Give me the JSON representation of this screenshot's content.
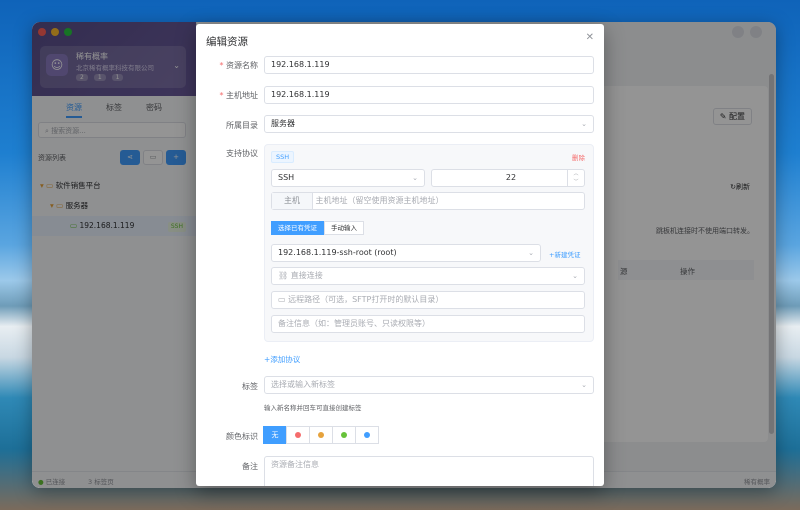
{
  "sidebar": {
    "org_name": "稀有概率",
    "org_sub": "北京稀有概率科技有限公司",
    "stats": [
      "2",
      "1",
      "1"
    ],
    "tabs": [
      "资源",
      "标签",
      "密码"
    ],
    "search_placeholder": "搜索资源...",
    "list_title": "资源列表",
    "tree": [
      {
        "label": "软件销售平台"
      },
      {
        "label": "服务器"
      },
      {
        "label": "192.168.1.119",
        "tag": "SSH"
      }
    ]
  },
  "footer": {
    "connected": "已连接",
    "count": "3 标签页",
    "right": "稀有概率"
  },
  "main": {
    "config": "配置",
    "refresh": "刷新",
    "note": "跳板机连接时不使用端口转发。",
    "col_op": "操作",
    "col_a": "源"
  },
  "dialog": {
    "title": "编辑资源",
    "name_label": "资源名称",
    "name_value": "192.168.1.119",
    "host_label": "主机地址",
    "host_value": "192.168.1.119",
    "dir_label": "所属目录",
    "dir_value": "服务器",
    "proto_label": "支持协议",
    "proto_badge": "SSH",
    "delete": "删除",
    "proto_value": "SSH",
    "port_value": "22",
    "host_seg": "主机",
    "host_placeholder": "主机地址（留空使用资源主机地址）",
    "cred_tab_1": "选择已有凭证",
    "cred_tab_2": "手动输入",
    "cred_value": "192.168.1.119-ssh-root (root)",
    "new_cred": "+新建凭证",
    "direct": "直接连接",
    "remote_path_placeholder": "远程路径（可选，SFTP打开时的默认目录）",
    "notes_placeholder": "备注信息（如：管理员账号、只读权限等）",
    "add_proto": "+添加协议",
    "tags_label": "标签",
    "tags_placeholder": "选择或输入新标签",
    "tags_hint": "输入新名称并回车可直接创建标签",
    "color_label": "颜色标识",
    "color_none": "无",
    "color_dots": [
      "#f56c6c",
      "#e6a23c",
      "#67c23a",
      "#409eff"
    ],
    "remark_label": "备注",
    "remark_placeholder": "资源备注信息"
  }
}
